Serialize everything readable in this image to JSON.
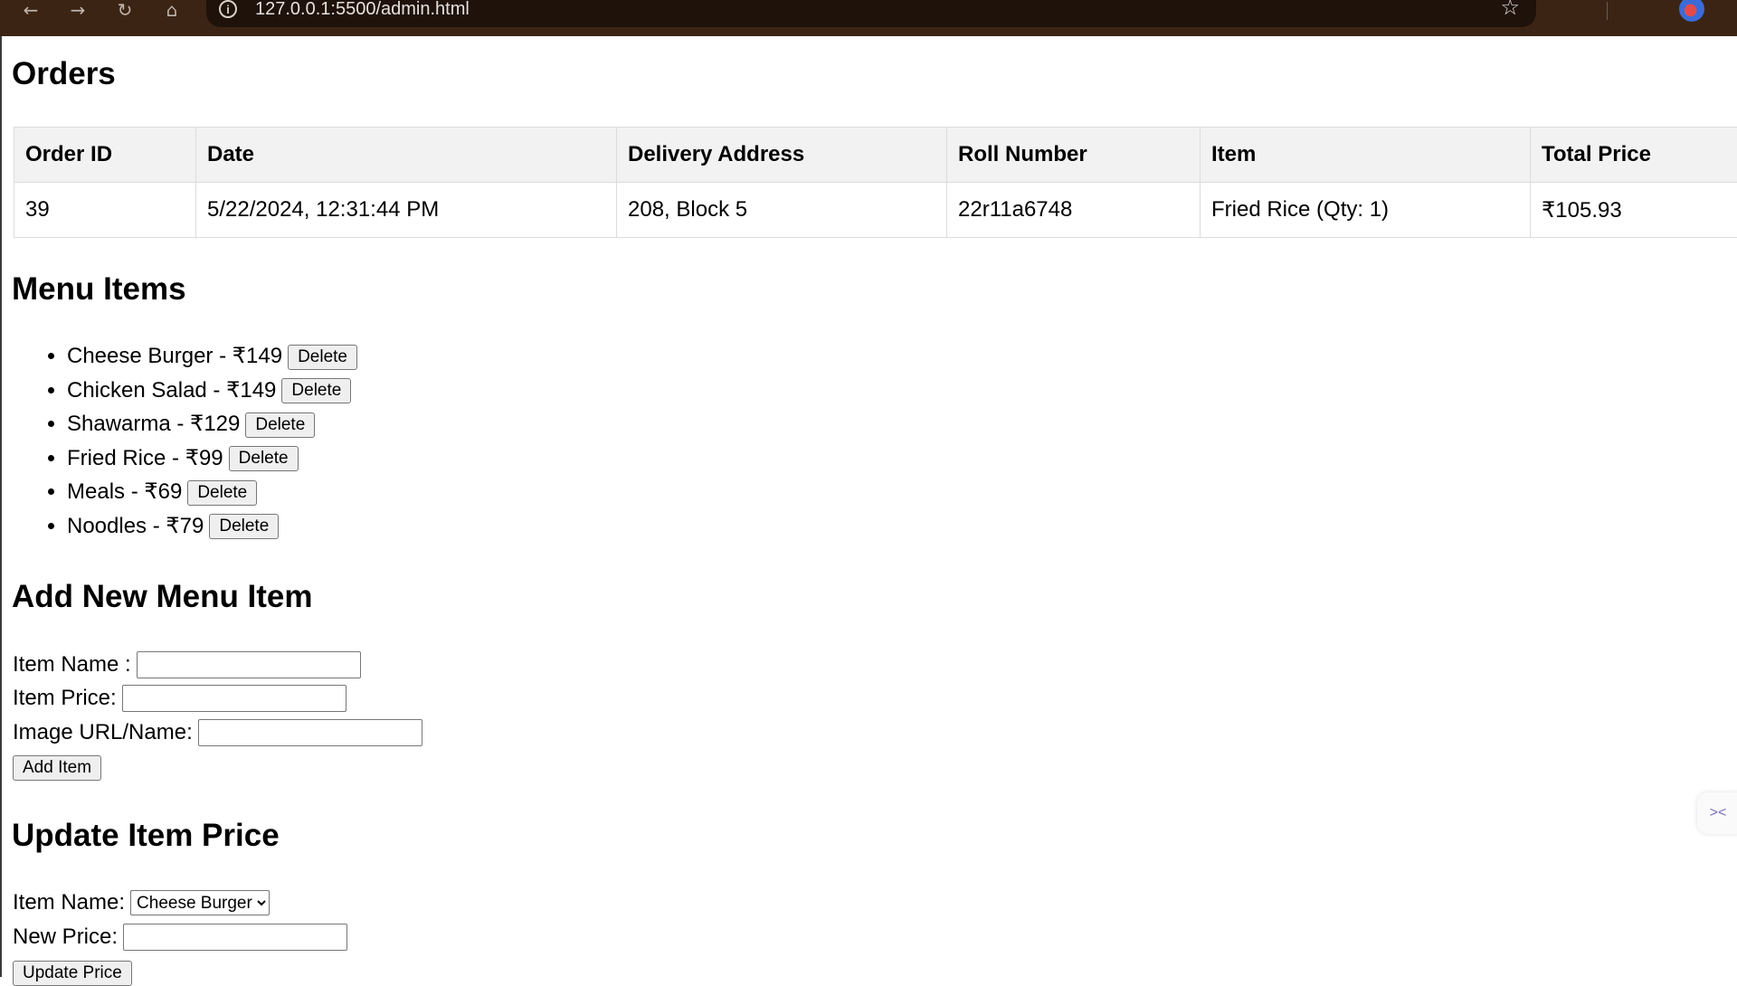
{
  "browser": {
    "url": "127.0.0.1:5500/admin.html"
  },
  "orders": {
    "heading": "Orders",
    "columns": [
      "Order ID",
      "Date",
      "Delivery Address",
      "Roll Number",
      "Item",
      "Total Price"
    ],
    "rows": [
      [
        "39",
        "5/22/2024, 12:31:44 PM",
        "208, Block 5",
        "22r11a6748",
        "Fried Rice (Qty: 1)",
        "₹105.93"
      ]
    ]
  },
  "menu": {
    "heading": "Menu Items",
    "delete_label": "Delete",
    "items": [
      {
        "label": "Cheese Burger - ₹149"
      },
      {
        "label": "Chicken Salad - ₹149"
      },
      {
        "label": "Shawarma - ₹129"
      },
      {
        "label": "Fried Rice - ₹99"
      },
      {
        "label": "Meals - ₹69"
      },
      {
        "label": "Noodles - ₹79"
      }
    ]
  },
  "add_item": {
    "heading": "Add New Menu Item",
    "name_label": "Item Name :",
    "name_value": "",
    "price_label": "Item Price:",
    "price_value": "",
    "image_label": "Image URL/Name:",
    "image_value": "",
    "button_label": "Add Item"
  },
  "update_price": {
    "heading": "Update Item Price",
    "name_label": "Item Name:",
    "selected_item": "Cheese Burger",
    "price_label": "New Price:",
    "price_value": "",
    "button_label": "Update Price"
  }
}
